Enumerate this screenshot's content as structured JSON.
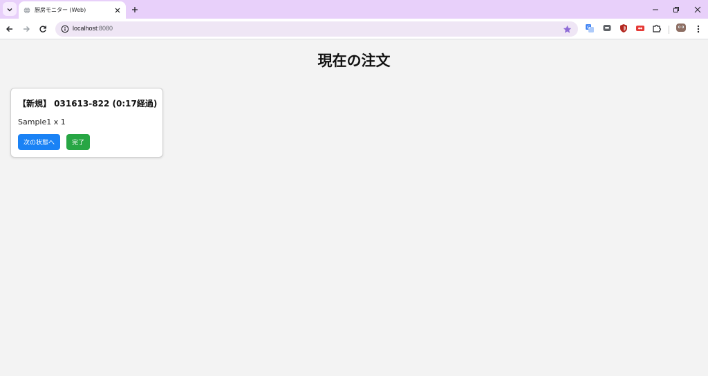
{
  "browser": {
    "tab_title": "厨房モニター (Web)",
    "url_host": "localhost",
    "url_port": ":8080",
    "icons": {
      "tab_search": "chevron-down-icon",
      "favicon": "globe-icon",
      "tab_close": "close-icon",
      "new_tab": "plus-icon",
      "back": "back-arrow-icon",
      "forward": "forward-arrow-icon",
      "reload": "reload-icon",
      "site_info": "info-icon",
      "bookmark": "star-icon",
      "extensions": [
        "translate-icon",
        "chat-icon",
        "shield-icon",
        "record-icon",
        "puzzle-icon"
      ],
      "profile": "avatar-icon",
      "menu": "kebab-menu-icon"
    },
    "colors": {
      "tabstrip": "#e8d0fa",
      "bookmark_star": "#8e6bd6"
    }
  },
  "page": {
    "title": "現在の注文",
    "orders": [
      {
        "title": "【新規】 031613-822 (0:17経過)",
        "item": "Sample1 x 1",
        "next_button": "次の状態へ",
        "done_button": "完了"
      }
    ]
  },
  "colors": {
    "next_button": "#1a82f5",
    "done_button": "#27a644"
  }
}
